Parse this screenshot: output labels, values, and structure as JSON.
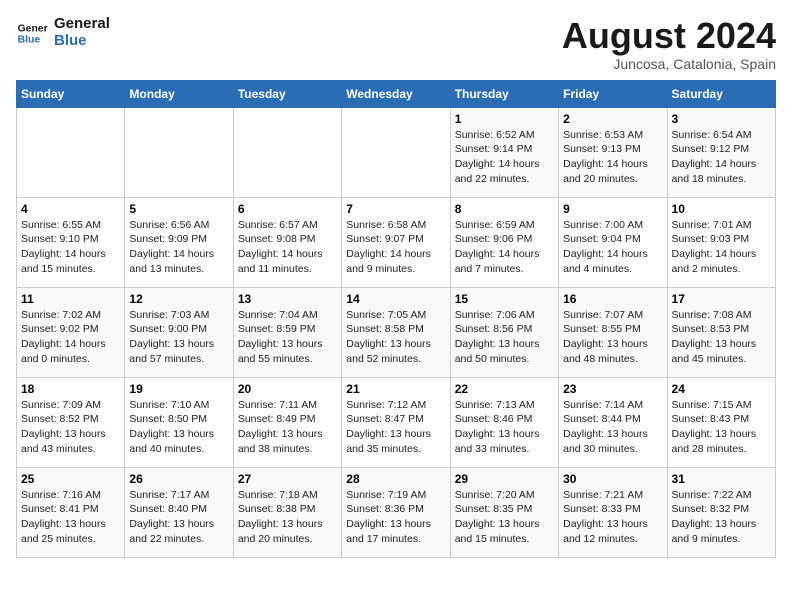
{
  "header": {
    "logo_line1": "General",
    "logo_line2": "Blue",
    "main_title": "August 2024",
    "subtitle": "Juncosa, Catalonia, Spain"
  },
  "days_of_week": [
    "Sunday",
    "Monday",
    "Tuesday",
    "Wednesday",
    "Thursday",
    "Friday",
    "Saturday"
  ],
  "weeks": [
    [
      {
        "day": "",
        "info": ""
      },
      {
        "day": "",
        "info": ""
      },
      {
        "day": "",
        "info": ""
      },
      {
        "day": "",
        "info": ""
      },
      {
        "day": "1",
        "info": "Sunrise: 6:52 AM\nSunset: 9:14 PM\nDaylight: 14 hours\nand 22 minutes."
      },
      {
        "day": "2",
        "info": "Sunrise: 6:53 AM\nSunset: 9:13 PM\nDaylight: 14 hours\nand 20 minutes."
      },
      {
        "day": "3",
        "info": "Sunrise: 6:54 AM\nSunset: 9:12 PM\nDaylight: 14 hours\nand 18 minutes."
      }
    ],
    [
      {
        "day": "4",
        "info": "Sunrise: 6:55 AM\nSunset: 9:10 PM\nDaylight: 14 hours\nand 15 minutes."
      },
      {
        "day": "5",
        "info": "Sunrise: 6:56 AM\nSunset: 9:09 PM\nDaylight: 14 hours\nand 13 minutes."
      },
      {
        "day": "6",
        "info": "Sunrise: 6:57 AM\nSunset: 9:08 PM\nDaylight: 14 hours\nand 11 minutes."
      },
      {
        "day": "7",
        "info": "Sunrise: 6:58 AM\nSunset: 9:07 PM\nDaylight: 14 hours\nand 9 minutes."
      },
      {
        "day": "8",
        "info": "Sunrise: 6:59 AM\nSunset: 9:06 PM\nDaylight: 14 hours\nand 7 minutes."
      },
      {
        "day": "9",
        "info": "Sunrise: 7:00 AM\nSunset: 9:04 PM\nDaylight: 14 hours\nand 4 minutes."
      },
      {
        "day": "10",
        "info": "Sunrise: 7:01 AM\nSunset: 9:03 PM\nDaylight: 14 hours\nand 2 minutes."
      }
    ],
    [
      {
        "day": "11",
        "info": "Sunrise: 7:02 AM\nSunset: 9:02 PM\nDaylight: 14 hours\nand 0 minutes."
      },
      {
        "day": "12",
        "info": "Sunrise: 7:03 AM\nSunset: 9:00 PM\nDaylight: 13 hours\nand 57 minutes."
      },
      {
        "day": "13",
        "info": "Sunrise: 7:04 AM\nSunset: 8:59 PM\nDaylight: 13 hours\nand 55 minutes."
      },
      {
        "day": "14",
        "info": "Sunrise: 7:05 AM\nSunset: 8:58 PM\nDaylight: 13 hours\nand 52 minutes."
      },
      {
        "day": "15",
        "info": "Sunrise: 7:06 AM\nSunset: 8:56 PM\nDaylight: 13 hours\nand 50 minutes."
      },
      {
        "day": "16",
        "info": "Sunrise: 7:07 AM\nSunset: 8:55 PM\nDaylight: 13 hours\nand 48 minutes."
      },
      {
        "day": "17",
        "info": "Sunrise: 7:08 AM\nSunset: 8:53 PM\nDaylight: 13 hours\nand 45 minutes."
      }
    ],
    [
      {
        "day": "18",
        "info": "Sunrise: 7:09 AM\nSunset: 8:52 PM\nDaylight: 13 hours\nand 43 minutes."
      },
      {
        "day": "19",
        "info": "Sunrise: 7:10 AM\nSunset: 8:50 PM\nDaylight: 13 hours\nand 40 minutes."
      },
      {
        "day": "20",
        "info": "Sunrise: 7:11 AM\nSunset: 8:49 PM\nDaylight: 13 hours\nand 38 minutes."
      },
      {
        "day": "21",
        "info": "Sunrise: 7:12 AM\nSunset: 8:47 PM\nDaylight: 13 hours\nand 35 minutes."
      },
      {
        "day": "22",
        "info": "Sunrise: 7:13 AM\nSunset: 8:46 PM\nDaylight: 13 hours\nand 33 minutes."
      },
      {
        "day": "23",
        "info": "Sunrise: 7:14 AM\nSunset: 8:44 PM\nDaylight: 13 hours\nand 30 minutes."
      },
      {
        "day": "24",
        "info": "Sunrise: 7:15 AM\nSunset: 8:43 PM\nDaylight: 13 hours\nand 28 minutes."
      }
    ],
    [
      {
        "day": "25",
        "info": "Sunrise: 7:16 AM\nSunset: 8:41 PM\nDaylight: 13 hours\nand 25 minutes."
      },
      {
        "day": "26",
        "info": "Sunrise: 7:17 AM\nSunset: 8:40 PM\nDaylight: 13 hours\nand 22 minutes."
      },
      {
        "day": "27",
        "info": "Sunrise: 7:18 AM\nSunset: 8:38 PM\nDaylight: 13 hours\nand 20 minutes."
      },
      {
        "day": "28",
        "info": "Sunrise: 7:19 AM\nSunset: 8:36 PM\nDaylight: 13 hours\nand 17 minutes."
      },
      {
        "day": "29",
        "info": "Sunrise: 7:20 AM\nSunset: 8:35 PM\nDaylight: 13 hours\nand 15 minutes."
      },
      {
        "day": "30",
        "info": "Sunrise: 7:21 AM\nSunset: 8:33 PM\nDaylight: 13 hours\nand 12 minutes."
      },
      {
        "day": "31",
        "info": "Sunrise: 7:22 AM\nSunset: 8:32 PM\nDaylight: 13 hours\nand 9 minutes."
      }
    ]
  ]
}
